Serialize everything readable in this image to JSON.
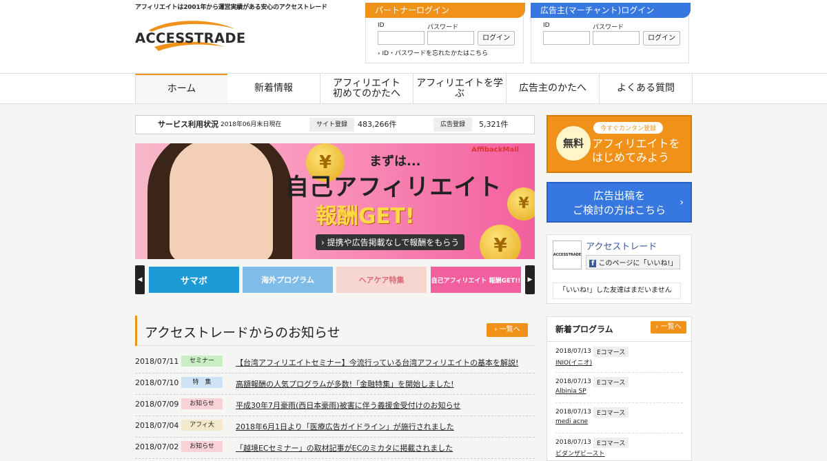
{
  "header": {
    "tagline": "アフィリエイトは2001年から運営実績がある安心のアクセストレード",
    "logo_text": "ACCESSTRADE"
  },
  "partner_login": {
    "title": "パートナーログイン",
    "id_label": "ID",
    "pw_label": "パスワード",
    "button": "ログイン",
    "forgot": "ID・パスワードを忘れたかたはこちら"
  },
  "merchant_login": {
    "title": "広告主(マーチャント)ログイン",
    "id_label": "ID",
    "pw_label": "パスワード",
    "button": "ログイン"
  },
  "nav": {
    "items": [
      {
        "label": "ホーム"
      },
      {
        "label": "新着情報"
      },
      {
        "label": "アフィリエイト\n初めてのかたへ"
      },
      {
        "label": "アフィリエイトを学ぶ"
      },
      {
        "label": "広告主のかたへ"
      },
      {
        "label": "よくある質問"
      }
    ]
  },
  "stats": {
    "label": "サービス利用状況",
    "as_of": "2018年06月末日現在",
    "site_label": "サイト登録",
    "site_value": "483,266件",
    "ad_label": "広告登録",
    "ad_value": "5,321件"
  },
  "banner": {
    "line1": "まずは...",
    "line2": "自己アフィリエイト",
    "line3": "報酬GET!",
    "line4": "› 提携や広告掲載なしで報酬をもらう",
    "brand": "AffibackMall"
  },
  "thumbnails": {
    "prev": "◀",
    "next": "▶",
    "items": [
      {
        "label": "サマボ",
        "color": "#1e9ad6"
      },
      {
        "label": "海外プログラム",
        "color": "#7fbde8"
      },
      {
        "label": "ヘアケア特集",
        "color": "#f7d6d0"
      },
      {
        "label": "自己アフィリエイト 報酬GET!!",
        "color": "#f35f9e"
      }
    ]
  },
  "news": {
    "title": "アクセストレードからのお知らせ",
    "more": "› 一覧へ",
    "rows": [
      {
        "date": "2018/07/11",
        "category": "セミナー",
        "cat_color": "#c9eec3",
        "text": "【台湾アフィリエイトセミナー】今流行っている台湾アフィリエイトの基本を解説!"
      },
      {
        "date": "2018/07/10",
        "category": "特　集",
        "cat_color": "#cfe3f7",
        "text": "高額報酬の人気プログラムが多数!「金融特集」を開始しました!"
      },
      {
        "date": "2018/07/09",
        "category": "お知らせ",
        "cat_color": "#f9d2d7",
        "text": "平成30年7月豪雨(西日本豪雨)被害に伴う義援金受付けのお知らせ"
      },
      {
        "date": "2018/07/04",
        "category": "アフィ大",
        "cat_color": "#f3e8c9",
        "text": "2018年6月1日より「医療広告ガイドライン」が施行されました"
      },
      {
        "date": "2018/07/02",
        "category": "お知らせ",
        "cat_color": "#f9d2d7",
        "text": "「越境ECセミナー」の取材記事がECのミカタに掲載されました"
      }
    ]
  },
  "cta_affiliate": {
    "free": "無料",
    "pill": "今すぐカンタン登録",
    "line1": "アフィリエイトを",
    "line2": "はじめてみよう"
  },
  "cta_advertiser": {
    "line1": "広告出稿を",
    "line2": "ご検討の方はこちら",
    "chevron": "›"
  },
  "facebook": {
    "logo_text": "ACCESSTRADE",
    "name": "アクセストレード",
    "like_icon": "f",
    "like": "このページに「いいね!」",
    "friends": "「いいね!」した友達はまだいません"
  },
  "programs": {
    "title": "新着プログラム",
    "more": "› 一覧へ",
    "rows": [
      {
        "date": "2018/07/13",
        "tag": "Eコマース",
        "name": "INIO(イニオ)"
      },
      {
        "date": "2018/07/13",
        "tag": "Eコマース",
        "name": "Albinia SP"
      },
      {
        "date": "2018/07/13",
        "tag": "Eコマース",
        "name": "medi acne"
      },
      {
        "date": "2018/07/13",
        "tag": "Eコマース",
        "name": "ビダンザビースト"
      }
    ]
  }
}
